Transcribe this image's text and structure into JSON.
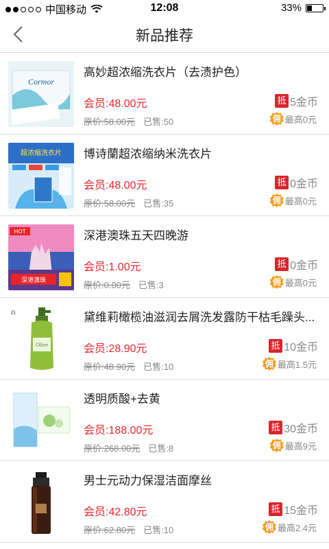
{
  "status_bar": {
    "carrier": "中国移动",
    "time": "12:08",
    "battery": "33%",
    "battery_level": 0.33
  },
  "nav": {
    "title": "新品推荐"
  },
  "products": [
    {
      "name": "高妙超浓缩洗衣片（去渍护色）",
      "member_price": "会员:48.00元",
      "original_price": "原价:58.00元",
      "sold": "已售:50",
      "coin_badge": "抵",
      "coins": "5金币",
      "commission_badge": "佣",
      "commission": "最高0元",
      "thumb_text": "Cormor"
    },
    {
      "name": "博诗蘭超浓缩纳米洗衣片",
      "member_price": "会员:48.00元",
      "original_price": "原价:58.00元",
      "sold": "已售:35",
      "coin_badge": "抵",
      "coins": "0金币",
      "commission_badge": "佣",
      "commission": "最高0元",
      "thumb_text": "超浓缩洗衣片"
    },
    {
      "name": "深港澳珠五天四晚游",
      "member_price": "会员:1.00元",
      "original_price": "原价:0.00元",
      "sold": "已售:3",
      "coin_badge": "抵",
      "coins": "0金币",
      "commission_badge": "佣",
      "commission": "最高0元",
      "thumb_text": "深港澳珠"
    },
    {
      "name": "黛维莉橄榄油滋润去屑洗发露防干枯毛躁头...",
      "member_price": "会员:28.90元",
      "original_price": "原价:48.90元",
      "sold": "已售:10",
      "coin_badge": "抵",
      "coins": "10金币",
      "commission_badge": "佣",
      "commission": "最高1.5元",
      "thumb_text": "Olive"
    },
    {
      "name": "透明质酸+去黄",
      "member_price": "会员:188.00元",
      "original_price": "原价:268.00元",
      "sold": "已售:8",
      "coin_badge": "抵",
      "coins": "30金币",
      "commission_badge": "佣",
      "commission": "最高9元",
      "thumb_text": ""
    },
    {
      "name": "男士元动力保湿洁面摩丝",
      "member_price": "会员:42.80元",
      "original_price": "原价:62.80元",
      "sold": "已售:10",
      "coin_badge": "抵",
      "coins": "15金币",
      "commission_badge": "佣",
      "commission": "最高2.4元",
      "thumb_text": ""
    }
  ],
  "colors": {
    "price_red": "#e2262d",
    "coin_badge": "#d9262b",
    "commission_badge": "#f29b1f",
    "divider": "#dcdcdc"
  }
}
